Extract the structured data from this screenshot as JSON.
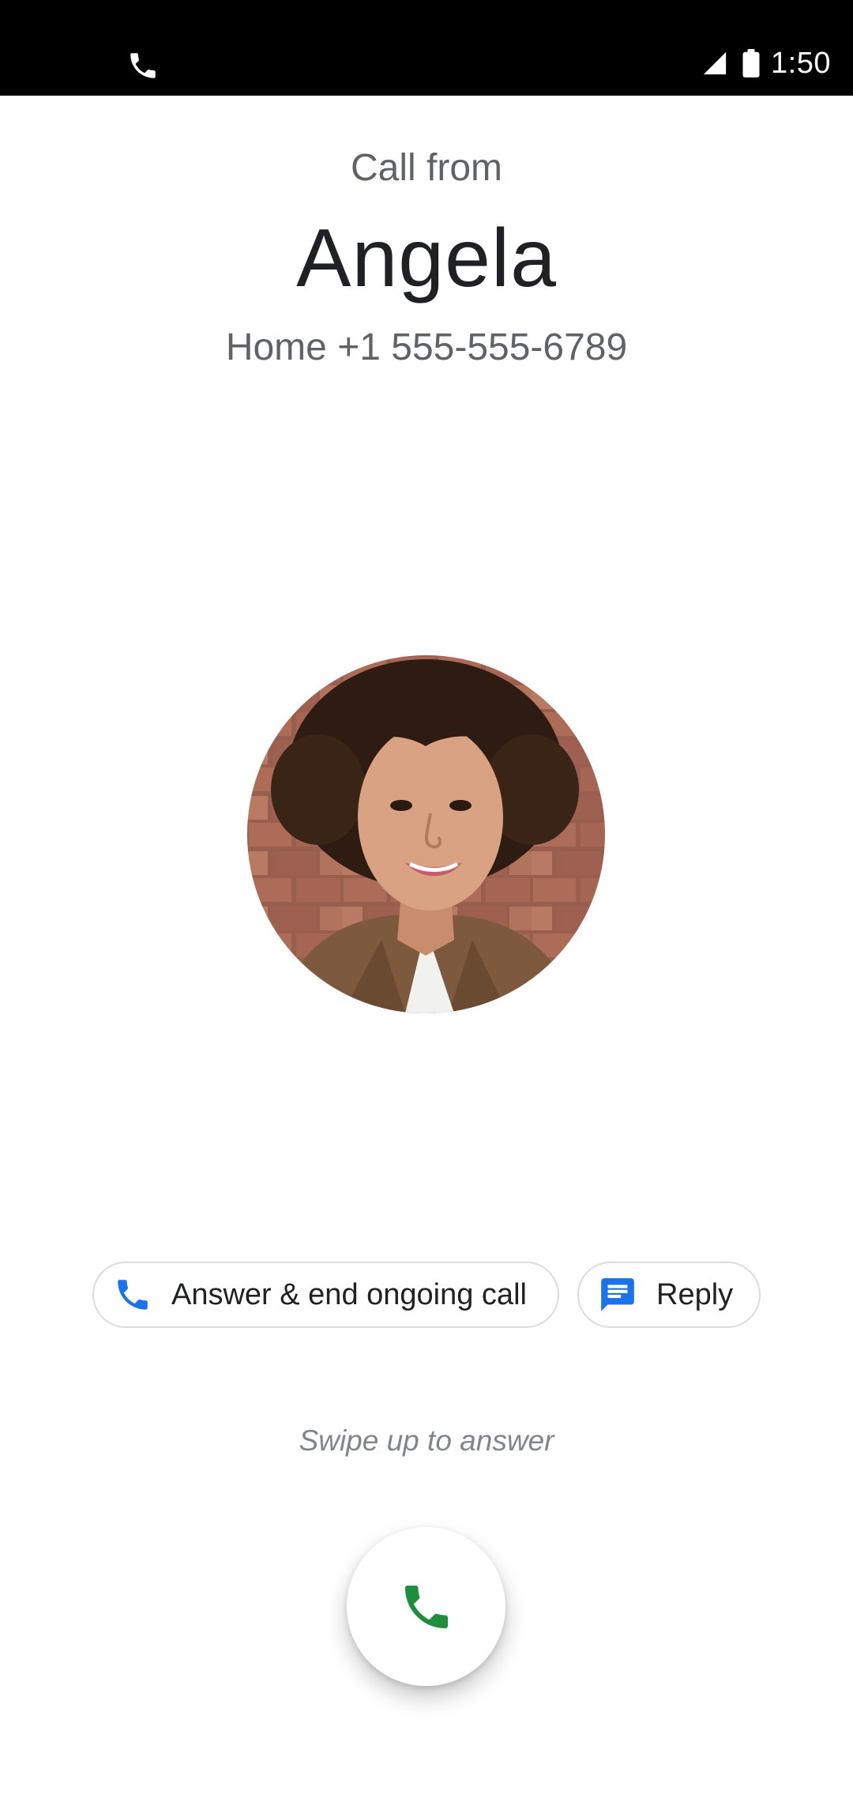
{
  "status_bar": {
    "time": "1:50",
    "icons": [
      "phone-call-icon",
      "cellular-signal-icon",
      "battery-icon"
    ]
  },
  "caller": {
    "label": "Call from",
    "name": "Angela",
    "number": "Home +1 555-555-6789"
  },
  "actions": {
    "answer_end": {
      "label": "Answer & end ongoing call",
      "icon": "phone-icon"
    },
    "reply": {
      "label": "Reply",
      "icon": "message-icon"
    }
  },
  "swipe_hint": "Swipe up to answer",
  "answer_button": {
    "icon": "phone-answer-icon"
  },
  "colors": {
    "status_bar_bg": "#000000",
    "background": "#ffffff",
    "primary_text": "#202124",
    "secondary_text": "#5f6368",
    "hint_text": "#80868b",
    "chip_border": "#dadce0",
    "accent_blue": "#1a73e8",
    "accent_green": "#1e8e3e"
  }
}
